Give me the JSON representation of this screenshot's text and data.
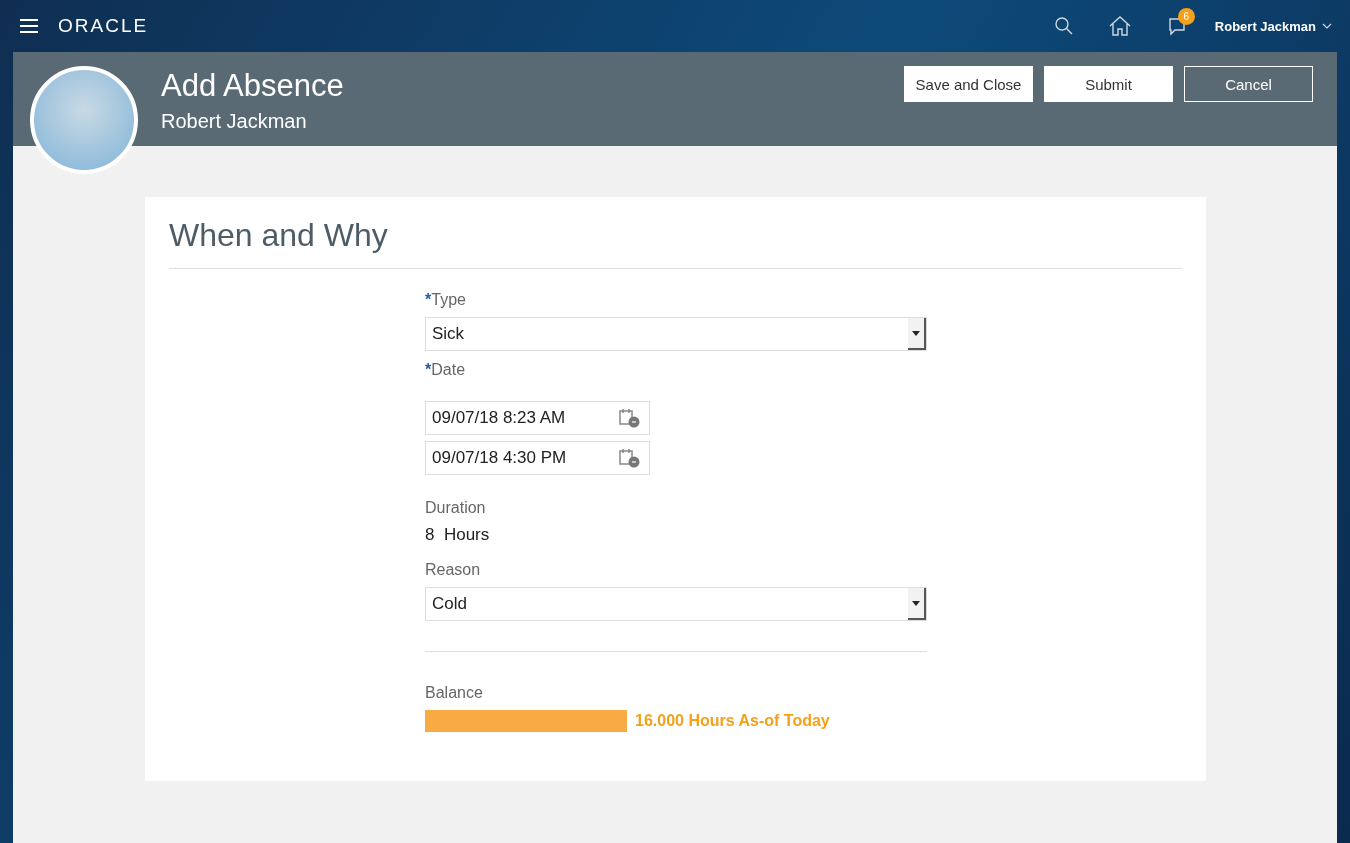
{
  "topbar": {
    "brand": "ORACLE",
    "notification_count": "6",
    "user": "Robert Jackman"
  },
  "header": {
    "title": "Add Absence",
    "subtitle": "Robert Jackman",
    "buttons": [
      {
        "label": "Save and Close",
        "kind": "filled"
      },
      {
        "label": "Submit",
        "kind": "filled"
      },
      {
        "label": "Cancel",
        "kind": "outline"
      }
    ]
  },
  "section": {
    "title": "When and Why",
    "required_mark": "*"
  },
  "fields": [
    {
      "kind": "select",
      "label": "Type",
      "required": true,
      "value": "Sick"
    },
    {
      "kind": "dates",
      "label": "Date",
      "required": true,
      "values": [
        "09/07/18 8:23 AM",
        "09/07/18 4:30 PM"
      ]
    },
    {
      "kind": "text",
      "label": "Duration",
      "required": false,
      "value": "8  Hours"
    },
    {
      "kind": "select",
      "label": "Reason",
      "required": false,
      "value": "Cold"
    }
  ],
  "balance": {
    "label": "Balance",
    "reading": "16.000 Hours As-of Today"
  }
}
